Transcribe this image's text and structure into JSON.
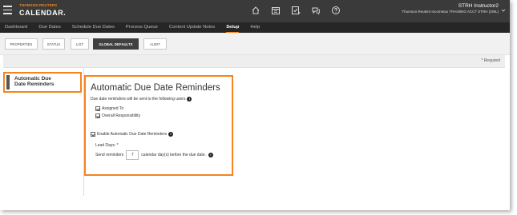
{
  "header": {
    "brand_company": "THOMSON REUTERS",
    "brand_app": "CALENDAR.",
    "user_name": "STRH Instructor2",
    "user_account": "Thomson Reuters Incometax TRAINING ACCT STRH (2WL)",
    "icons": [
      "home-icon",
      "calendar-icon",
      "task-icon",
      "chat-icon",
      "help-icon"
    ]
  },
  "nav": {
    "items": [
      {
        "label": "Dashboard"
      },
      {
        "label": "Due Dates"
      },
      {
        "label": "Schedule Due Dates"
      },
      {
        "label": "Process Queue"
      },
      {
        "label": "Content Update Notes"
      },
      {
        "label": "Setup"
      },
      {
        "label": "Help"
      }
    ],
    "active": "Setup"
  },
  "tabs": {
    "items": [
      {
        "label": "PROPERTIES"
      },
      {
        "label": "STATUS"
      },
      {
        "label": "LIST"
      },
      {
        "label": "GLOBAL DEFAULTS"
      },
      {
        "label": "AUDIT"
      }
    ],
    "active": "GLOBAL DEFAULTS"
  },
  "required_note": "* Required",
  "side_nav": {
    "items": [
      {
        "label": "Automatic Due Date Reminders"
      }
    ]
  },
  "panel": {
    "title": "Automatic Due Date Reminders",
    "description": "Due date reminders will be sent to the following users",
    "checkboxes": [
      {
        "label": "Assigned To",
        "checked": true
      },
      {
        "label": "Overall Responsibility",
        "checked": true
      }
    ],
    "enable_label": "Enable Automatic Due Date Reminders",
    "enable_checked": true,
    "lead_days_label": "Lead Days: *",
    "send_prefix": "Send reminders",
    "days_value": "7",
    "send_suffix": "calendar day(s) before the due date."
  },
  "colors": {
    "accent": "#f5841f",
    "topbar": "#3a3a3a",
    "navbar": "#262626"
  }
}
